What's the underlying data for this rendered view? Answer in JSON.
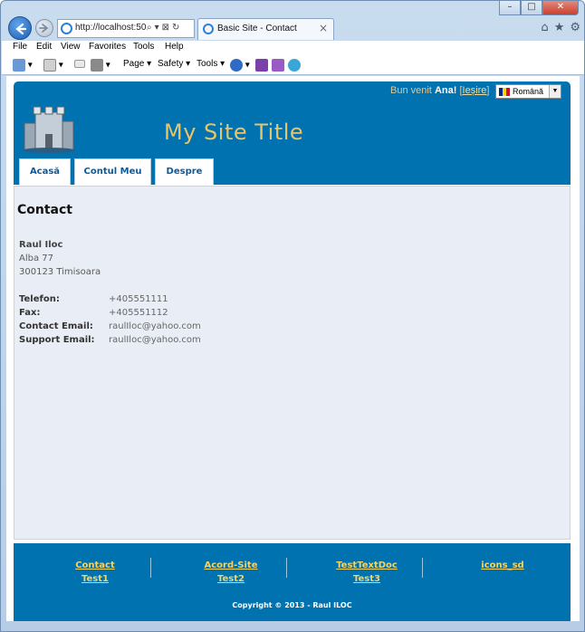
{
  "browser": {
    "url": "http://localhost:50",
    "tab_title": "Basic Site - Contact",
    "tab_close": "×",
    "menu": [
      "File",
      "Edit",
      "View",
      "Favorites",
      "Tools",
      "Help"
    ],
    "command_bar": [
      "Page ▾",
      "Safety ▾",
      "Tools ▾"
    ],
    "window_controls": [
      "–",
      "□",
      "✕"
    ]
  },
  "header": {
    "welcome": "Bun venit",
    "user": "Ana!",
    "logout_open": "[",
    "logout": "Ieșire",
    "logout_close": "]",
    "language": "Română",
    "site_title": "My Site Title"
  },
  "nav": [
    "Acasă",
    "Contul Meu",
    "Despre"
  ],
  "page": {
    "heading": "Contact",
    "address": {
      "name": "Raul Iloc",
      "street": "Alba 77",
      "city": "300123 Timisoara"
    },
    "contacts": [
      {
        "label": "Telefon:",
        "value": "+405551111"
      },
      {
        "label": "Fax:",
        "value": "+405551112"
      },
      {
        "label": "Contact Email:",
        "value": "raulIloc@yahoo.com"
      },
      {
        "label": "Support Email:",
        "value": "raulIloc@yahoo.com"
      }
    ]
  },
  "footer": {
    "columns": [
      [
        "Contact",
        "Test1"
      ],
      [
        "Acord-Site",
        "Test2"
      ],
      [
        "TestTextDoc",
        "Test3"
      ],
      [
        "icons_sd"
      ]
    ],
    "copyright": "Copyright © 2013 - Raul ILOC"
  },
  "colors": {
    "header_bg": "#0072b0",
    "title_gold": "#e8c46a",
    "content_bg": "#e9edf5"
  }
}
